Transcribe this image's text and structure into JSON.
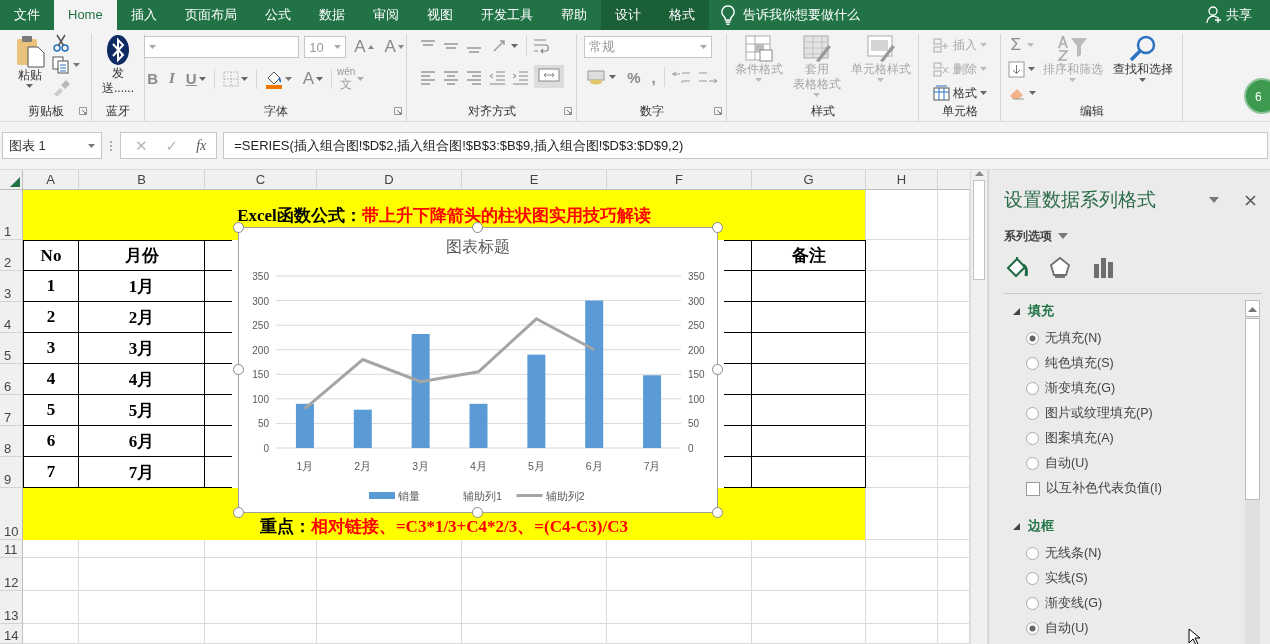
{
  "ribbon": {
    "tabs": [
      {
        "label": "文件",
        "selected": false,
        "kind": "plain"
      },
      {
        "label": "Home",
        "selected": true,
        "kind": "plain"
      },
      {
        "label": "插入",
        "selected": false,
        "kind": "plain"
      },
      {
        "label": "页面布局",
        "selected": false,
        "kind": "plain"
      },
      {
        "label": "公式",
        "selected": false,
        "kind": "plain"
      },
      {
        "label": "数据",
        "selected": false,
        "kind": "plain"
      },
      {
        "label": "审阅",
        "selected": false,
        "kind": "plain"
      },
      {
        "label": "视图",
        "selected": false,
        "kind": "plain"
      },
      {
        "label": "开发工具",
        "selected": false,
        "kind": "plain"
      },
      {
        "label": "帮助",
        "selected": false,
        "kind": "plain"
      },
      {
        "label": "设计",
        "selected": false,
        "kind": "context"
      },
      {
        "label": "格式",
        "selected": false,
        "kind": "context"
      }
    ],
    "tell_me": "告诉我你想要做什么",
    "share": "共享",
    "clipboard": {
      "label": "剪贴板",
      "paste": "粘贴"
    },
    "bluetooth": {
      "label": "蓝牙",
      "send": [
        "发",
        "送......"
      ]
    },
    "font": {
      "label": "字体",
      "font_size": "10",
      "grow_font": "A",
      "shrink_font": "A",
      "bold": "B",
      "italic": "I",
      "underline": "U",
      "font_color": "A",
      "phonetic_top": "wén",
      "phonetic_bottom": "文"
    },
    "alignment": {
      "label": "对齐方式"
    },
    "number": {
      "label": "数字",
      "format": "常规",
      "percent": "%",
      "comma": ","
    },
    "styles": {
      "label": "样式",
      "buttons": [
        {
          "label": "条件格式",
          "disabled": true
        },
        {
          "label": [
            "套用",
            "表格格式"
          ],
          "disabled": true
        },
        {
          "label": "单元格样式",
          "disabled": true
        }
      ]
    },
    "cells": {
      "label": "单元格",
      "buttons": [
        {
          "label": "插入",
          "disabled": true
        },
        {
          "label": "删除",
          "disabled": true
        },
        {
          "label": "格式",
          "disabled": false
        }
      ]
    },
    "editing": {
      "label": "编辑",
      "autosum": "Σ",
      "buttons": [
        {
          "label": "排序和筛选",
          "disabled": true
        },
        {
          "label": "查找和选择",
          "disabled": false
        }
      ]
    },
    "badge": "6"
  },
  "formula_bar": {
    "name_box": "图表 1",
    "cancel": "✕",
    "enter": "✓",
    "function": "fx",
    "formula": "=SERIES(插入组合图!$D$2,插入组合图!$B$3:$B$9,插入组合图!$D$3:$D$9,2)"
  },
  "sheet": {
    "columns": [
      "A",
      "B",
      "C",
      "D",
      "E",
      "F",
      "G",
      "H"
    ],
    "row_numbers": [
      "1",
      "2",
      "3",
      "4",
      "5",
      "6",
      "7",
      "8",
      "9",
      "10",
      "11",
      "12",
      "13",
      "14"
    ],
    "title": {
      "label": "Excel函数公式：",
      "text": "带上升下降箭头的柱状图实用技巧解读"
    },
    "header": {
      "A": "No",
      "B": "月份",
      "G": "备注"
    },
    "rows": [
      {
        "A": "1",
        "B": "1月"
      },
      {
        "A": "2",
        "B": "2月"
      },
      {
        "A": "3",
        "B": "3月"
      },
      {
        "A": "4",
        "B": "4月"
      },
      {
        "A": "5",
        "B": "5月"
      },
      {
        "A": "6",
        "B": "6月"
      },
      {
        "A": "7",
        "B": "7月"
      }
    ],
    "note": {
      "label": "重点：",
      "text": "相对链接、=C3*1/3+C4*2/3、=(C4-C3)/C3"
    }
  },
  "chart": {
    "selected": true,
    "chart_data": {
      "type": "bar",
      "title": "图表标题",
      "categories": [
        "1月",
        "2月",
        "3月",
        "4月",
        "5月",
        "6月",
        "7月"
      ],
      "ylim": [
        0,
        350
      ],
      "yticks": [
        0,
        50,
        100,
        150,
        200,
        250,
        300,
        350
      ],
      "y2lim": [
        0,
        350
      ],
      "y2ticks": [
        0,
        50,
        100,
        150,
        200,
        250,
        300,
        350
      ],
      "grid": true,
      "legend": "bottom",
      "series": [
        {
          "name": "销量",
          "type": "bar",
          "color": "#5b9bd5",
          "values": [
            90,
            78,
            232,
            90,
            190,
            300,
            148
          ]
        },
        {
          "name": "辅助列1",
          "type": "bar",
          "values": [
            null,
            null,
            null,
            null,
            null,
            null,
            null
          ]
        },
        {
          "name": "辅助列2",
          "type": "line",
          "color": "#a5a5a5",
          "values": [
            80,
            180,
            135,
            155,
            263,
            200,
            null
          ]
        }
      ]
    }
  },
  "pane": {
    "title": "设置数据系列格式",
    "options_label": "系列选项",
    "tabs": [
      {
        "selected": true
      },
      {
        "selected": false
      },
      {
        "selected": false
      }
    ],
    "sections": [
      {
        "title": "填充",
        "expanded": true,
        "options": [
          {
            "kind": "radio",
            "label": "无填充(N)",
            "selected": true
          },
          {
            "kind": "radio",
            "label": "纯色填充(S)",
            "selected": false
          },
          {
            "kind": "radio",
            "label": "渐变填充(G)",
            "selected": false
          },
          {
            "kind": "radio",
            "label": "图片或纹理填充(P)",
            "selected": false
          },
          {
            "kind": "radio",
            "label": "图案填充(A)",
            "selected": false
          },
          {
            "kind": "radio",
            "label": "自动(U)",
            "selected": false
          },
          {
            "kind": "checkbox",
            "label": "以互补色代表负值(I)",
            "checked": false
          }
        ]
      },
      {
        "title": "边框",
        "expanded": true,
        "options": [
          {
            "kind": "radio",
            "label": "无线条(N)",
            "selected": false
          },
          {
            "kind": "radio",
            "label": "实线(S)",
            "selected": false
          },
          {
            "kind": "radio",
            "label": "渐变线(G)",
            "selected": false
          },
          {
            "kind": "radio",
            "label": "自动(U)",
            "selected": true
          }
        ]
      }
    ]
  }
}
